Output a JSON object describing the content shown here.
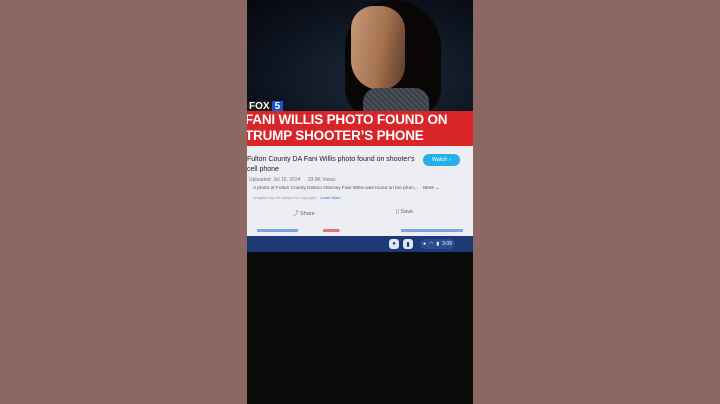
{
  "news": {
    "logo_fox": "FOX",
    "logo_number": "5",
    "headline_line1": "FANI WILLIS PHOTO FOUND ON",
    "headline_line2": "TRUMP SHOOTER’S PHONE"
  },
  "video": {
    "title": "Fulton County DA Fani Willis photo found on shooter's cell phone",
    "watch_label": "Watch",
    "uploaded": "Uploaded: Jul 16, 2024",
    "views": "33.9K Views",
    "description": "A photo of Fulton County District Attorney Fani Willis was found on the phon...",
    "more_label": "More",
    "disclaimer": "Images may be subject to copyright.",
    "learn_more": "Learn More",
    "share_label": "Share",
    "save_label": "Save"
  },
  "taskbar": {
    "time": "3:09"
  },
  "colors": {
    "headline_red": "#d9242a",
    "watch_blue": "#24b0e8",
    "taskbar_blue": "#1d3a77"
  },
  "icons": [
    "share-icon",
    "bookmark-icon",
    "chevron-right-icon",
    "chevron-down-icon",
    "wifi-icon",
    "battery-icon"
  ]
}
